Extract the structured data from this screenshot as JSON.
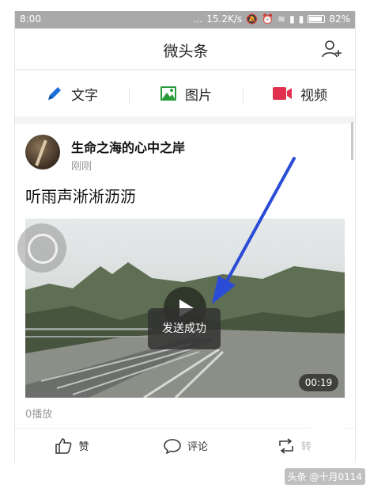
{
  "status_bar": {
    "time": "8:00",
    "dots": "...",
    "net_speed": "15.2K/s",
    "battery": "82%"
  },
  "header": {
    "title": "微头条",
    "add_user_icon": "person-plus-icon"
  },
  "compose": {
    "items": [
      {
        "label": "文字",
        "icon": "pencil-icon",
        "color": "#1b6fd8"
      },
      {
        "label": "图片",
        "icon": "image-icon",
        "color": "#2a9b3c"
      },
      {
        "label": "视频",
        "icon": "video-camera-icon",
        "color": "#e0304d"
      }
    ]
  },
  "post": {
    "author": "生命之海的心中之岸",
    "time": "刚刚",
    "text": "听雨声淅淅沥沥",
    "video_duration": "00:19",
    "plays": "0播放",
    "toast": "发送成功"
  },
  "actions": [
    {
      "label": "赞",
      "icon": "thumbs-up-icon"
    },
    {
      "label": "评论",
      "icon": "comment-icon"
    },
    {
      "label": "转发",
      "icon": "share-icon"
    }
  ],
  "watermark": "头条 @十月0114",
  "colors": {
    "annotation_arrow": "#2b4cd6"
  }
}
